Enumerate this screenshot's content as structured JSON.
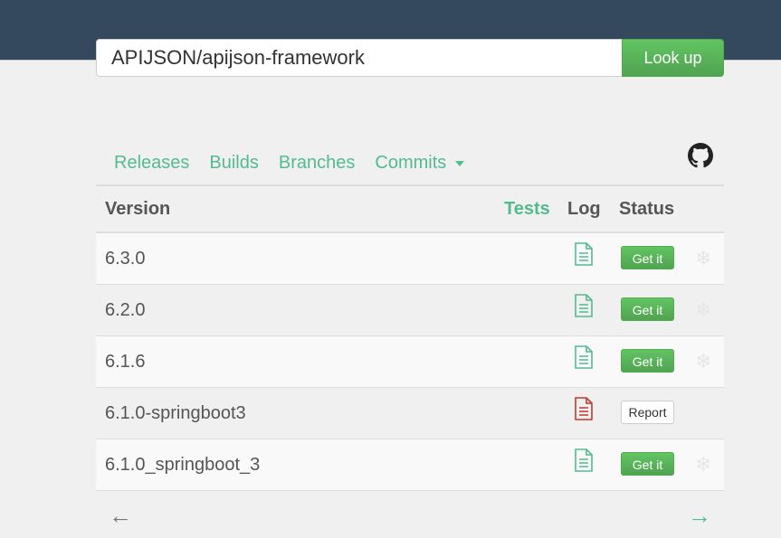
{
  "search": {
    "value": "APIJSON/apijson-framework",
    "button_label": "Look up"
  },
  "tabs": [
    {
      "label": "Releases"
    },
    {
      "label": "Builds"
    },
    {
      "label": "Branches"
    },
    {
      "label": "Commits"
    }
  ],
  "github_icon": "github-icon",
  "table": {
    "headers": {
      "version": "Version",
      "tests": "Tests",
      "log": "Log",
      "status": "Status"
    },
    "rows": [
      {
        "version": "6.3.0",
        "log": "ok",
        "status": "Get it",
        "snapshot": true
      },
      {
        "version": "6.2.0",
        "log": "ok",
        "status": "Get it",
        "snapshot": true
      },
      {
        "version": "6.1.6",
        "log": "ok",
        "status": "Get it",
        "snapshot": true
      },
      {
        "version": "6.1.0-springboot3",
        "log": "error",
        "status": "Report",
        "snapshot": false
      },
      {
        "version": "6.1.0_springboot_3",
        "log": "ok",
        "status": "Get it",
        "snapshot": true
      }
    ]
  },
  "pager": {
    "prev": "←",
    "next": "→"
  },
  "colors": {
    "header_bg": "#34495e",
    "accent": "#52bb8f",
    "button_green": "#5cb85c",
    "log_ok": "#52bb8f",
    "log_error": "#c0392b"
  }
}
